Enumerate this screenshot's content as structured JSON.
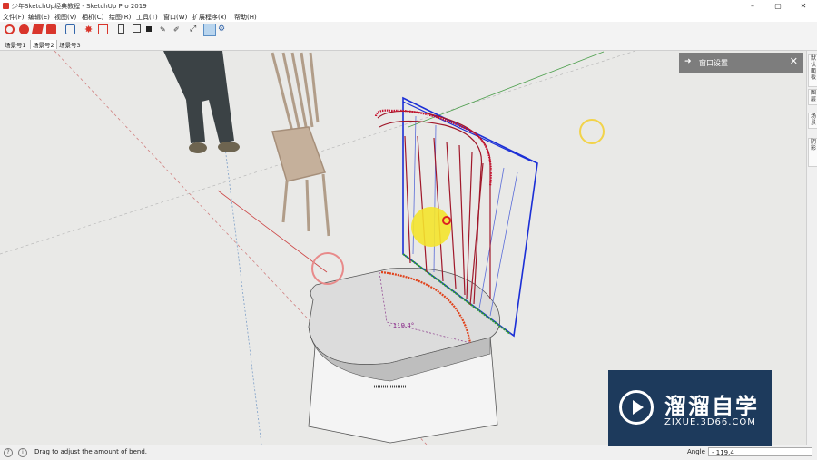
{
  "window": {
    "title": "少年SketchUp经典教程 - SketchUp Pro 2019"
  },
  "menu": [
    "文件(F)",
    "编辑(E)",
    "视图(V)",
    "相机(C)",
    "绘图(R)",
    "工具(T)",
    "窗口(W)",
    "扩展程序(x)",
    "帮助(H)"
  ],
  "scene_tabs": [
    "场景号1",
    "场景号2",
    "场景号3"
  ],
  "tray": {
    "title": "窗口设置"
  },
  "right_tabs": [
    "默认面板",
    "图层",
    "场景",
    "阴影"
  ],
  "status": {
    "hint": "Drag to adjust the amount of bend."
  },
  "measurements": {
    "label": "Angle",
    "value": "- 119.4"
  },
  "viewport_annotation": "- 119.4°",
  "watermark": {
    "name": "溜溜自学",
    "url": "ZIXUE.3D66.COM"
  },
  "colors": {
    "accent": "#d9352b",
    "tray": "#7d7d7d",
    "watermark_bg": "#1d3a5c"
  }
}
